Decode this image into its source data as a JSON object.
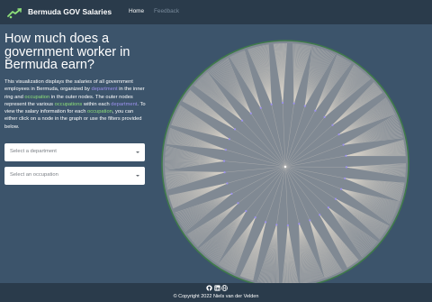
{
  "navbar": {
    "brand": "Bermuda GOV Salaries",
    "links": [
      "Home",
      "Feedback"
    ]
  },
  "main": {
    "heading": "How much does a government worker in Bermuda earn?",
    "description": {
      "part1": "This visualization displays the salaries of all government employees in Bermuda, organized by ",
      "dept1": "department",
      "part2": " in the inner ring and ",
      "occ1": "occupation",
      "part3": " in the outer nodes. The outer nodes represent the various ",
      "occ2": "occupations",
      "part4": " within each ",
      "dept2": "department",
      "part5": ". To view the salary information for each ",
      "occ3": "occupation",
      "part6": ", you can either click on a node in the graph or use the filters provided below."
    },
    "filters": {
      "department_placeholder": "Select a department",
      "occupation_placeholder": "Select an occupation"
    }
  },
  "footer": {
    "icons": [
      "github-icon",
      "linkedin-icon",
      "globe-icon"
    ],
    "copyright": "© Copyright 2022 Niels van der Velden"
  },
  "colors": {
    "background": "#3c546b",
    "navbar": "#2a3b4b",
    "department": "#9d92ee",
    "occupation": "#8ee07a",
    "circle_fill": "#808993",
    "circle_border": "#3f7a4b",
    "link": "#d8d2c8"
  }
}
